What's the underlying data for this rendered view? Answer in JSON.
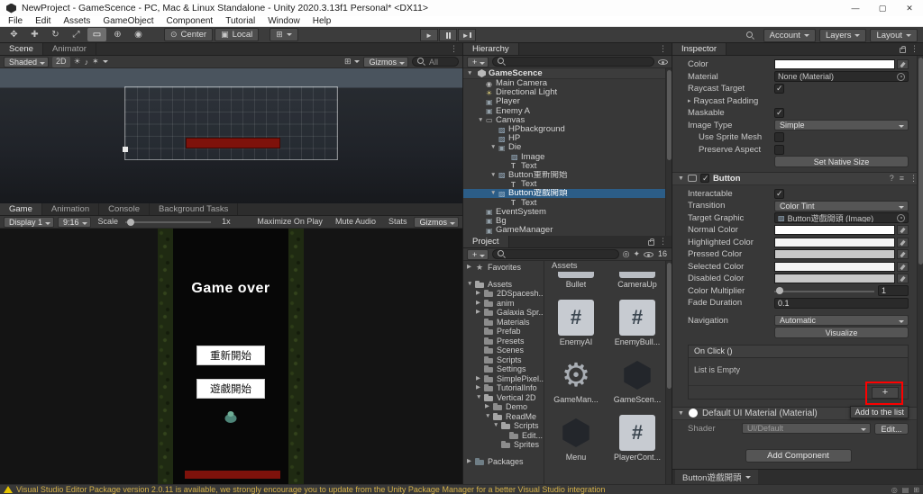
{
  "titlebar": {
    "title": "NewProject - GameScence - PC, Mac & Linux Standalone - Unity 2020.3.13f1 Personal* <DX11>"
  },
  "menubar": {
    "items": [
      {
        "label": "File"
      },
      {
        "label": "Edit"
      },
      {
        "label": "Assets"
      },
      {
        "label": "GameObject"
      },
      {
        "label": "Component"
      },
      {
        "label": "Tutorial"
      },
      {
        "label": "Window"
      },
      {
        "label": "Help"
      }
    ]
  },
  "toolbar": {
    "pivot": "Center",
    "space": "Local",
    "account": "Account",
    "layers": "Layers",
    "layout": "Layout"
  },
  "scene": {
    "tabs": [
      {
        "label": "Scene",
        "active": true
      },
      {
        "label": "Animator"
      }
    ],
    "shading": "Shaded",
    "toggle_2d": "2D",
    "gizmos": "Gizmos",
    "search_text": "All"
  },
  "game": {
    "tabs": [
      {
        "label": "Game",
        "active": true
      },
      {
        "label": "Animation"
      },
      {
        "label": "Console"
      },
      {
        "label": "Background Tasks"
      }
    ],
    "display": "Display 1",
    "aspect": "9:16",
    "scale_label": "Scale",
    "scale_value": "1x",
    "right_buttons": [
      {
        "label": "Maximize On Play"
      },
      {
        "label": "Mute Audio"
      },
      {
        "label": "Stats"
      }
    ],
    "gizmos": "Gizmos",
    "overlay": {
      "game_over": "Game over",
      "restart_button": "重新開始",
      "start_button": "遊戲開始"
    }
  },
  "hierarchy": {
    "tab": "Hierarchy",
    "add_label": "+",
    "scene_name": "GameScence",
    "rows": [
      {
        "label": "Main Camera",
        "indent": 1,
        "icon": "camera"
      },
      {
        "label": "Directional Light",
        "indent": 1,
        "icon": "light"
      },
      {
        "label": "Player",
        "indent": 1,
        "icon": "go"
      },
      {
        "label": "Enemy A",
        "indent": 1,
        "icon": "go"
      },
      {
        "label": "Canvas",
        "indent": 1,
        "icon": "canvas",
        "expand": "down"
      },
      {
        "label": "HPbackground",
        "indent": 2,
        "icon": "image"
      },
      {
        "label": "HP",
        "indent": 2,
        "icon": "image"
      },
      {
        "label": "Die",
        "indent": 2,
        "icon": "go",
        "expand": "down"
      },
      {
        "label": "Image",
        "indent": 3,
        "icon": "image"
      },
      {
        "label": "Text",
        "indent": 3,
        "icon": "text"
      },
      {
        "label": "Button重新開始",
        "indent": 2,
        "icon": "image",
        "expand": "down"
      },
      {
        "label": "Text",
        "indent": 3,
        "icon": "text"
      },
      {
        "label": "Button遊戲開頭",
        "indent": 2,
        "icon": "image",
        "expand": "down",
        "selected": true
      },
      {
        "label": "Text",
        "indent": 3,
        "icon": "text"
      },
      {
        "label": "EventSystem",
        "indent": 1,
        "icon": "go"
      },
      {
        "label": "Bg",
        "indent": 1,
        "icon": "go"
      },
      {
        "label": "GameManager",
        "indent": 1,
        "icon": "go"
      }
    ]
  },
  "project": {
    "tab": "Project",
    "add_label": "+",
    "hidden_count": "16",
    "tree": [
      {
        "label": "Favorites",
        "indent": 0,
        "icon": "star",
        "expand": "right"
      },
      {
        "label": "Assets",
        "indent": 0,
        "icon": "folder-open",
        "expand": "down",
        "gap": true
      },
      {
        "label": "2DSpacesh...",
        "indent": 1,
        "icon": "folder",
        "expand": "right"
      },
      {
        "label": "anim",
        "indent": 1,
        "icon": "folder",
        "expand": "right"
      },
      {
        "label": "Galaxia Spr...",
        "indent": 1,
        "icon": "folder",
        "expand": "right"
      },
      {
        "label": "Materials",
        "indent": 1,
        "icon": "folder"
      },
      {
        "label": "Prefab",
        "indent": 1,
        "icon": "folder"
      },
      {
        "label": "Presets",
        "indent": 1,
        "icon": "folder"
      },
      {
        "label": "Scenes",
        "indent": 1,
        "icon": "folder"
      },
      {
        "label": "Scripts",
        "indent": 1,
        "icon": "folder"
      },
      {
        "label": "Settings",
        "indent": 1,
        "icon": "folder"
      },
      {
        "label": "SimplePixel...",
        "indent": 1,
        "icon": "folder",
        "expand": "right"
      },
      {
        "label": "TutorialInfo",
        "indent": 1,
        "icon": "folder",
        "expand": "right"
      },
      {
        "label": "Vertical 2D",
        "indent": 1,
        "icon": "folder-open",
        "expand": "down"
      },
      {
        "label": "Demo",
        "indent": 2,
        "icon": "folder",
        "expand": "right"
      },
      {
        "label": "ReadMe",
        "indent": 2,
        "icon": "folder-open",
        "expand": "down"
      },
      {
        "label": "Scripts",
        "indent": 3,
        "icon": "folder-open",
        "expand": "down"
      },
      {
        "label": "Edit...",
        "indent": 4,
        "icon": "folder"
      },
      {
        "label": "Sprites",
        "indent": 3,
        "icon": "folder"
      },
      {
        "label": "Packages",
        "indent": 0,
        "icon": "package",
        "expand": "right",
        "gap": true
      }
    ],
    "grid_header": "Assets",
    "assets": [
      {
        "name": "Bullet",
        "type": "clipped"
      },
      {
        "name": "CameraUp",
        "type": "clipped"
      },
      {
        "name": "EnemyAI",
        "type": "script"
      },
      {
        "name": "EnemyBull...",
        "type": "script"
      },
      {
        "name": "GameMan...",
        "type": "gear"
      },
      {
        "name": "GameScen...",
        "type": "unity"
      },
      {
        "name": "Menu",
        "type": "unity"
      },
      {
        "name": "PlayerCont...",
        "type": "script"
      }
    ]
  },
  "inspector": {
    "tab": "Inspector",
    "image": {
      "color_label": "Color",
      "color_value": "#FFFFFF",
      "material_label": "Material",
      "material_value": "None (Material)",
      "raycast_target_label": "Raycast Target",
      "raycast_target_checked": true,
      "raycast_padding_label": "Raycast Padding",
      "maskable_label": "Maskable",
      "maskable_checked": true,
      "image_type_label": "Image Type",
      "image_type_value": "Simple",
      "use_sprite_mesh_label": "Use Sprite Mesh",
      "use_sprite_mesh_checked": false,
      "preserve_aspect_label": "Preserve Aspect",
      "preserve_aspect_checked": false,
      "set_native_size_label": "Set Native Size"
    },
    "button": {
      "title": "Button",
      "enabled": true,
      "interactable_label": "Interactable",
      "interactable_checked": true,
      "transition_label": "Transition",
      "transition_value": "Color Tint",
      "target_graphic_label": "Target Graphic",
      "target_graphic_value": "Button遊戲開頭 (Image)",
      "color_rows": [
        {
          "label": "Normal Color",
          "hex": "#FFFFFF"
        },
        {
          "label": "Highlighted Color",
          "hex": "#F5F5F5"
        },
        {
          "label": "Pressed Color",
          "hex": "#C8C8C8"
        },
        {
          "label": "Selected Color",
          "hex": "#F5F5F5"
        },
        {
          "label": "Disabled Color",
          "hex": "#C8C8C8"
        }
      ],
      "color_multiplier_label": "Color Multiplier",
      "color_multiplier_value": "1",
      "fade_duration_label": "Fade Duration",
      "fade_duration_value": "0.1",
      "navigation_label": "Navigation",
      "navigation_value": "Automatic",
      "visualize_label": "Visualize",
      "on_click_header": "On Click ()",
      "list_empty": "List is Empty",
      "add_button": "+",
      "add_tooltip": "Add to the list"
    },
    "material": {
      "name": "Default UI Material (Material)",
      "shader_label": "Shader",
      "shader_value": "UI/Default",
      "edit_label": "Edit..."
    },
    "add_component_label": "Add Component",
    "bottom_tab": "Button遊戲開頭"
  },
  "statusbar": {
    "message": "Visual Studio Editor Package version 2.0.11 is available, we strongly encourage you to update from the Unity Package Manager for a better Visual Studio integration"
  }
}
